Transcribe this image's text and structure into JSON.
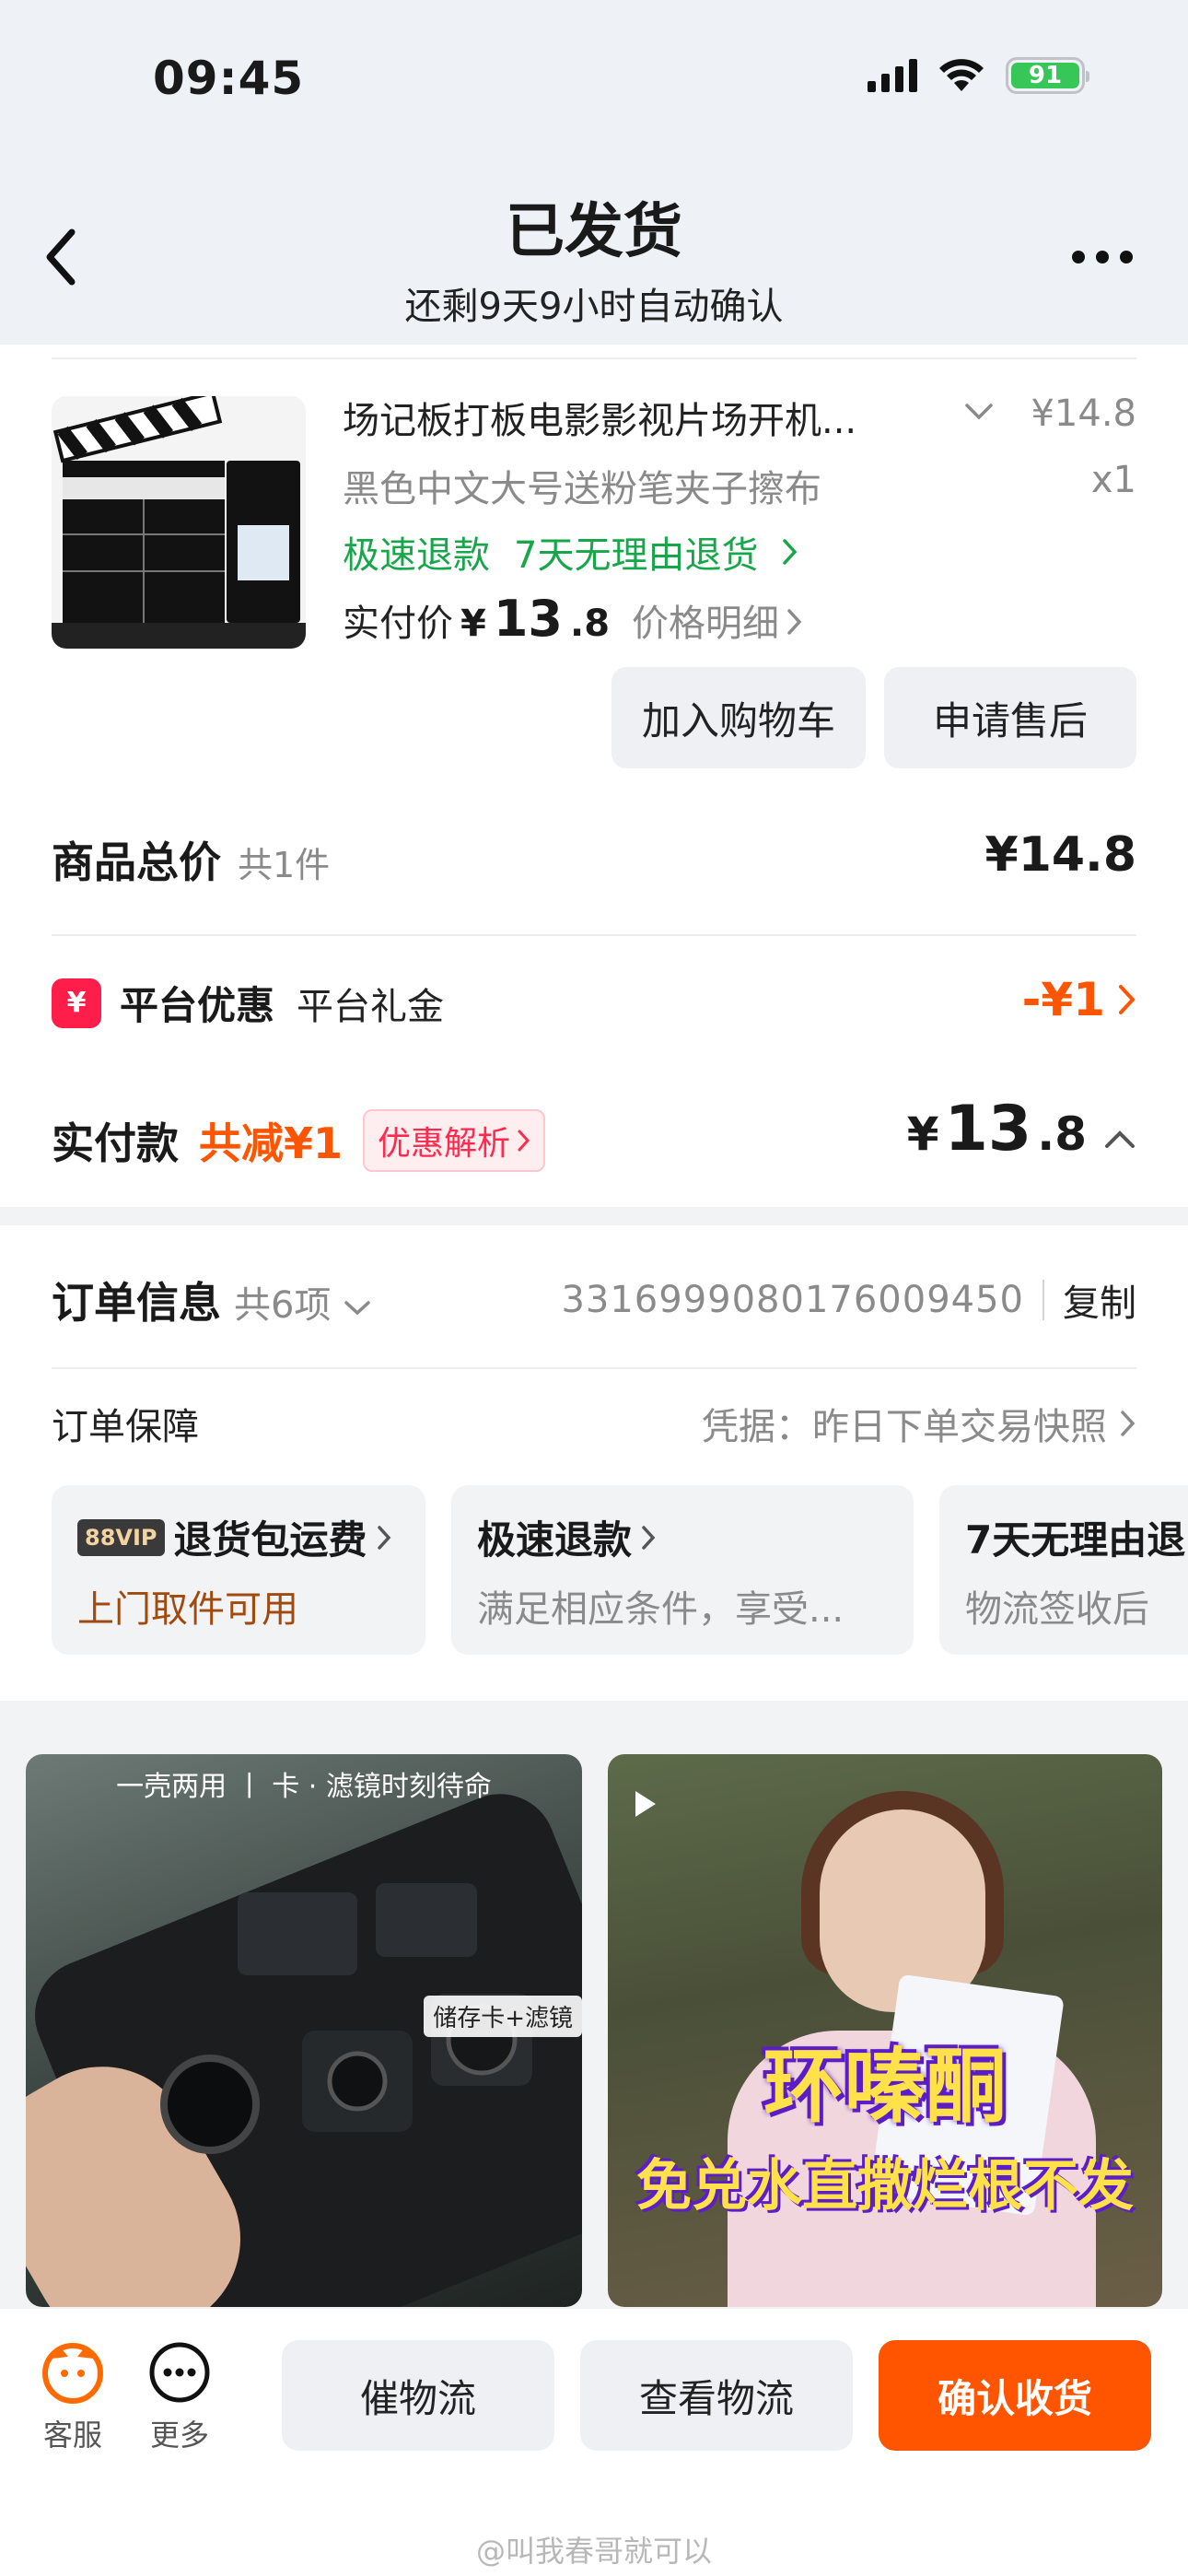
{
  "status_bar": {
    "time": "09:45",
    "battery": "91"
  },
  "header": {
    "title": "已发货",
    "subtitle": "还剩9天9小时自动确认"
  },
  "product": {
    "name": "场记板打板电影影视片场开机...",
    "price": "¥14.8",
    "spec": "黑色中文大号送粉笔夹子擦布",
    "qty": "x1",
    "tag_refund": "极速退款",
    "tag_return": "7天无理由退货",
    "paid_label": "实付价",
    "paid_yen": "¥",
    "paid_int": "13",
    "paid_dec": ".8",
    "price_detail": "价格明细",
    "btn_cart": "加入购物车",
    "btn_aftersale": "申请售后"
  },
  "summary": {
    "total_label": "商品总价",
    "total_count": "共1件",
    "total_value": "¥14.8",
    "promo_label": "平台优惠",
    "promo_sub": "平台礼金",
    "promo_value": "-¥1",
    "paid_label": "实付款",
    "paid_discount": "共减¥1",
    "paid_badge": "优惠解析",
    "paid_yen": "¥",
    "paid_int": "13",
    "paid_dec": ".8"
  },
  "order_info": {
    "title": "订单信息",
    "count": "共6项",
    "order_number": "3316999080176009450",
    "copy": "复制",
    "guarantee_label": "订单保障",
    "guarantee_proof": "凭据：昨日下单交易快照",
    "cards": [
      {
        "badge": "88VIP",
        "title": "退货包运费",
        "desc": "上门取件可用"
      },
      {
        "title": "极速退款",
        "desc": "满足相应条件，享受..."
      },
      {
        "title": "7天无理由退",
        "desc": "物流签收后"
      }
    ]
  },
  "feed": {
    "item1_caption": "一壳两用 丨 卡 · 滤镜时刻待命",
    "item1_label": "储存卡+滤镜",
    "item2_title": "环嗪酮",
    "item2_subtitle": "免兑水直撒烂根不发"
  },
  "bottom_bar": {
    "service": "客服",
    "more": "更多",
    "btn_urge": "催物流",
    "btn_view": "查看物流",
    "btn_confirm": "确认收货"
  },
  "watermark": "@叫我春哥就可以",
  "colors": {
    "accent": "#ff5500",
    "green": "#18a64a",
    "pink": "#ff2a4e"
  }
}
